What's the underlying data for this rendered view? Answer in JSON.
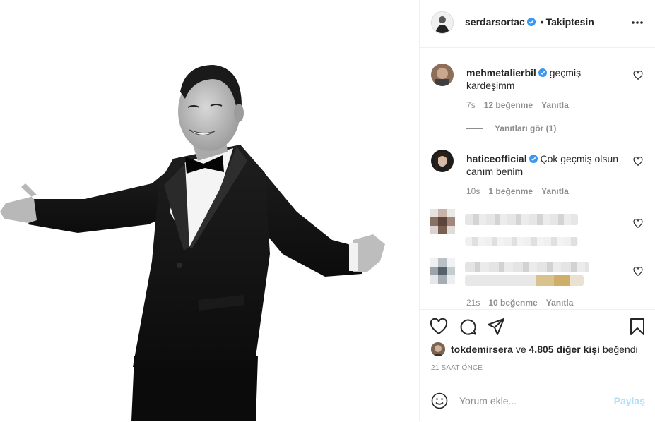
{
  "header": {
    "username": "serdarsortac",
    "separator": "•",
    "follow_label": "Takiptesin"
  },
  "comments": [
    {
      "username": "mehmetalierbil",
      "verified": true,
      "text": "geçmiş kardeşimm",
      "time": "7s",
      "likes": "12 beğenme",
      "reply": "Yanıtla",
      "view_replies": "Yanıtları gör (1)"
    },
    {
      "username": "haticeofficial",
      "verified": true,
      "text": "Çok geçmiş olsun canım benim",
      "time": "10s",
      "likes": "1 beğenme",
      "reply": "Yanıtla"
    },
    {
      "username": "",
      "blurred": true
    },
    {
      "username": "",
      "blurred": true,
      "time": "21s",
      "likes": "10 beğenme",
      "reply": "Yanıtla"
    }
  ],
  "likes": {
    "user": "tokdemirsera",
    "connector": "ve",
    "others": "4.805 diğer kişi",
    "suffix": "beğendi"
  },
  "timestamp": "21 SAAT ÖNCE",
  "comment_input": {
    "placeholder": "Yorum ekle...",
    "share_label": "Paylaş"
  },
  "colors": {
    "verified": "#3897f0",
    "share_disabled": "#b2dffc",
    "muted": "#8e8e8e"
  },
  "icons": [
    "heart-icon",
    "comment-icon",
    "share-icon",
    "bookmark-icon",
    "emoji-icon",
    "more-icon"
  ]
}
